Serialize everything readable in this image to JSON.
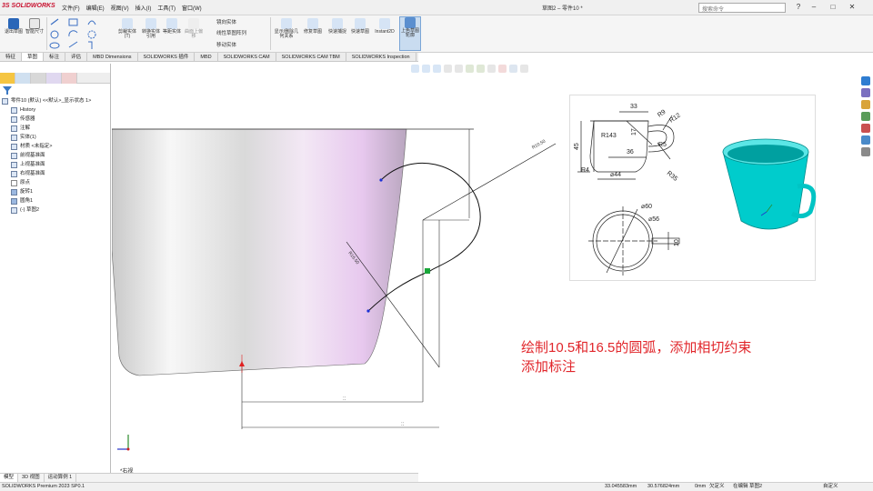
{
  "app": {
    "brand": "3S SOLIDWORKS",
    "window_title": "草图2 – 零件10 *",
    "search_placeholder": "搜索命令"
  },
  "menu": [
    "文件(F)",
    "编辑(E)",
    "视图(V)",
    "插入(I)",
    "工具(T)",
    "窗口(W)"
  ],
  "ribbon": {
    "buttons": [
      "退出草图",
      "智能尺寸",
      "剪裁实体(T)",
      "转换实体引用",
      "等距实体",
      "曲面上偏移",
      "显示/删除几何关系",
      "修复草图",
      "快速捕捉",
      "快速草图",
      "Instant2D",
      "上色草图轮廓"
    ],
    "small_items": [
      "镜向实体",
      "线性草图阵列",
      "移动实体"
    ]
  },
  "command_tabs": [
    "特征",
    "草图",
    "标注",
    "评估",
    "MBD Dimensions",
    "SOLIDWORKS 插件",
    "MBD",
    "SOLIDWORKS CAM",
    "SOLIDWORKS CAM TBM",
    "SOLIDWORKS Inspection"
  ],
  "active_command_tab": "草图",
  "tree": {
    "root": "零件10 (默认) <<默认>_显示状态 1>",
    "items": [
      "History",
      "传感器",
      "注解",
      "实体(1)",
      "材质 <未指定>",
      "前视基准面",
      "上视基准面",
      "右视基准面",
      "原点",
      "旋转1",
      "圆角1",
      "(-) 草图2"
    ]
  },
  "bottom_tabs": [
    "模型",
    "3D 视图",
    "运动算例 1"
  ],
  "active_bottom_tab": "模型",
  "view_label": "*右视",
  "annotation": {
    "line1": "绘制10.5和16.5的圆弧，添加相切约束",
    "line2": "添加标注"
  },
  "drawing_labels": {
    "dim_a": "33",
    "dim_b": "17",
    "dim_c": "45",
    "r143": "R143",
    "r12": "R12",
    "r5": "R5",
    "r4": "R4",
    "dia44": "⌀44",
    "dim36": "36",
    "r35": "R35",
    "dia60": "⌀60",
    "dia56": "⌀56",
    "dim10": "10",
    "r9": "R9"
  },
  "statusbar": {
    "product": "SOLIDWORKS Premium 2023 SP0.1",
    "x": "33.045583mm",
    "y": "30.576824mm",
    "z": "0mm",
    "state": "欠定义",
    "mode": "在编辑 草图2",
    "units": "自定义"
  },
  "colors": {
    "mug": "#00d0d0",
    "annotation": "#e1262b",
    "brand": "#c8102e"
  }
}
